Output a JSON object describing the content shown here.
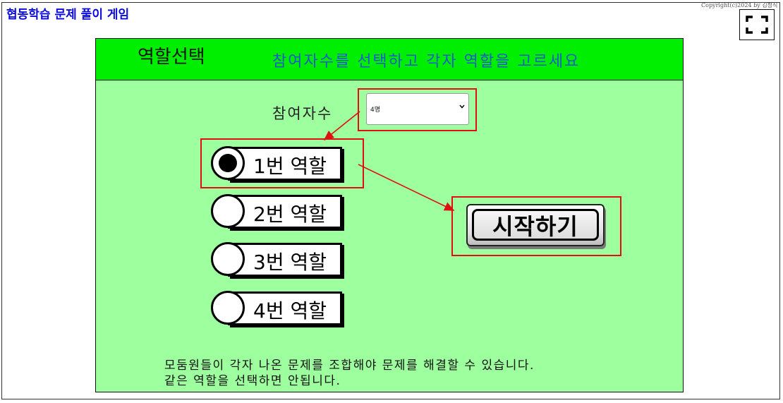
{
  "app": {
    "title": "협동학습 문제 풀이 게임",
    "copyright": "Copyright(c)2024 by 김정식"
  },
  "panel": {
    "title": "역할선택",
    "subtitle": "참여자수를 선택하고 각자 역할을 고르세요",
    "participant_label": "참여자수",
    "participant_select": {
      "selected": "4명",
      "caret": "⌄"
    },
    "roles": [
      {
        "label": "1번 역할",
        "checked": true
      },
      {
        "label": "2번 역할",
        "checked": false
      },
      {
        "label": "3번 역할",
        "checked": false
      },
      {
        "label": "4번 역할",
        "checked": false
      }
    ],
    "start_button": "시작하기",
    "instructions": {
      "line1": "모둠원들이 각자 나온 문제를 조합해야 문제를 해결할 수 있습니다.",
      "line2": "같은 역할을 선택하면 안됩니다."
    }
  },
  "icons": {
    "fullscreen": "fullscreen-icon"
  },
  "colors": {
    "title_blue": "#0a0adc",
    "header_green": "#00ee00",
    "panel_green": "#9dff9d",
    "subtitle_blue": "#1a5cc8",
    "annotation_red": "#e01010"
  }
}
